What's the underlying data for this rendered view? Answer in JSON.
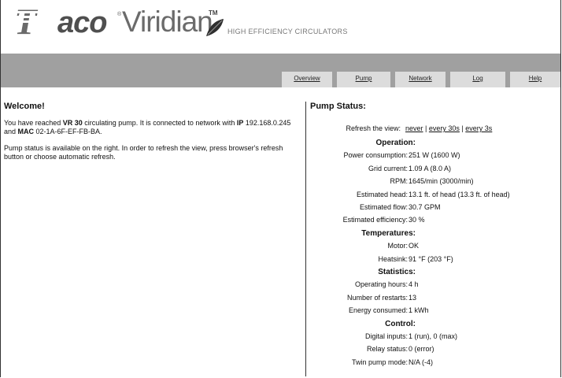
{
  "brand": {
    "logo_prefix": "Taco",
    "logo_name": "Viridian",
    "tm": "TM",
    "tagline": "HIGH EFFICIENCY CIRCULATORS"
  },
  "nav": {
    "tabs": [
      "Overview",
      "Pump",
      "Network",
      "Log",
      "Help"
    ]
  },
  "welcome": {
    "title": "Welcome!",
    "p1_a": "You have reached ",
    "model": "VR 30",
    "p1_b": " circulating pump. It is connected to network with ",
    "ip_label": "IP",
    "ip": " 192.168.0.245",
    "p1_c": " and ",
    "mac_label": "MAC",
    "mac": " 02-1A-6F-EF-FB-BA.",
    "p2": "Pump status is available on the right. In order to refresh the view, press browser's refresh button or choose automatic refresh."
  },
  "status": {
    "title": "Pump Status:",
    "refresh_label": "Refresh the view:",
    "refresh_links": [
      "never",
      "every 30s",
      "every 3s"
    ],
    "separator": "|",
    "sections": [
      {
        "heading": "Operation:",
        "rows": [
          {
            "k": "Power consumption:",
            "v": "251 W (1600 W)"
          },
          {
            "k": "Grid current:",
            "v": "1.09 A (8.0 A)"
          },
          {
            "k": "RPM:",
            "v": "1645/min (3000/min)"
          },
          {
            "k": "Estimated head:",
            "v": "13.1 ft. of head (13.3 ft. of head)"
          },
          {
            "k": "Estimated flow:",
            "v": "30.7 GPM"
          },
          {
            "k": "Estimated efficiency:",
            "v": "30 %"
          }
        ]
      },
      {
        "heading": "Temperatures:",
        "rows": [
          {
            "k": "Motor:",
            "v": "OK"
          },
          {
            "k": "Heatsink:",
            "v": "91 °F (203 °F)"
          }
        ]
      },
      {
        "heading": "Statistics:",
        "rows": [
          {
            "k": "Operating hours:",
            "v": "4 h"
          },
          {
            "k": "Number of restarts:",
            "v": "13"
          },
          {
            "k": "Energy consumed:",
            "v": "1 kWh"
          }
        ]
      },
      {
        "heading": "Control:",
        "rows": [
          {
            "k": "Digital inputs:",
            "v": "1 (run), 0 (max)"
          },
          {
            "k": "Relay status:",
            "v": "0 (error)"
          },
          {
            "k": "Twin pump mode:",
            "v": "N/A (-4)"
          }
        ]
      }
    ]
  }
}
